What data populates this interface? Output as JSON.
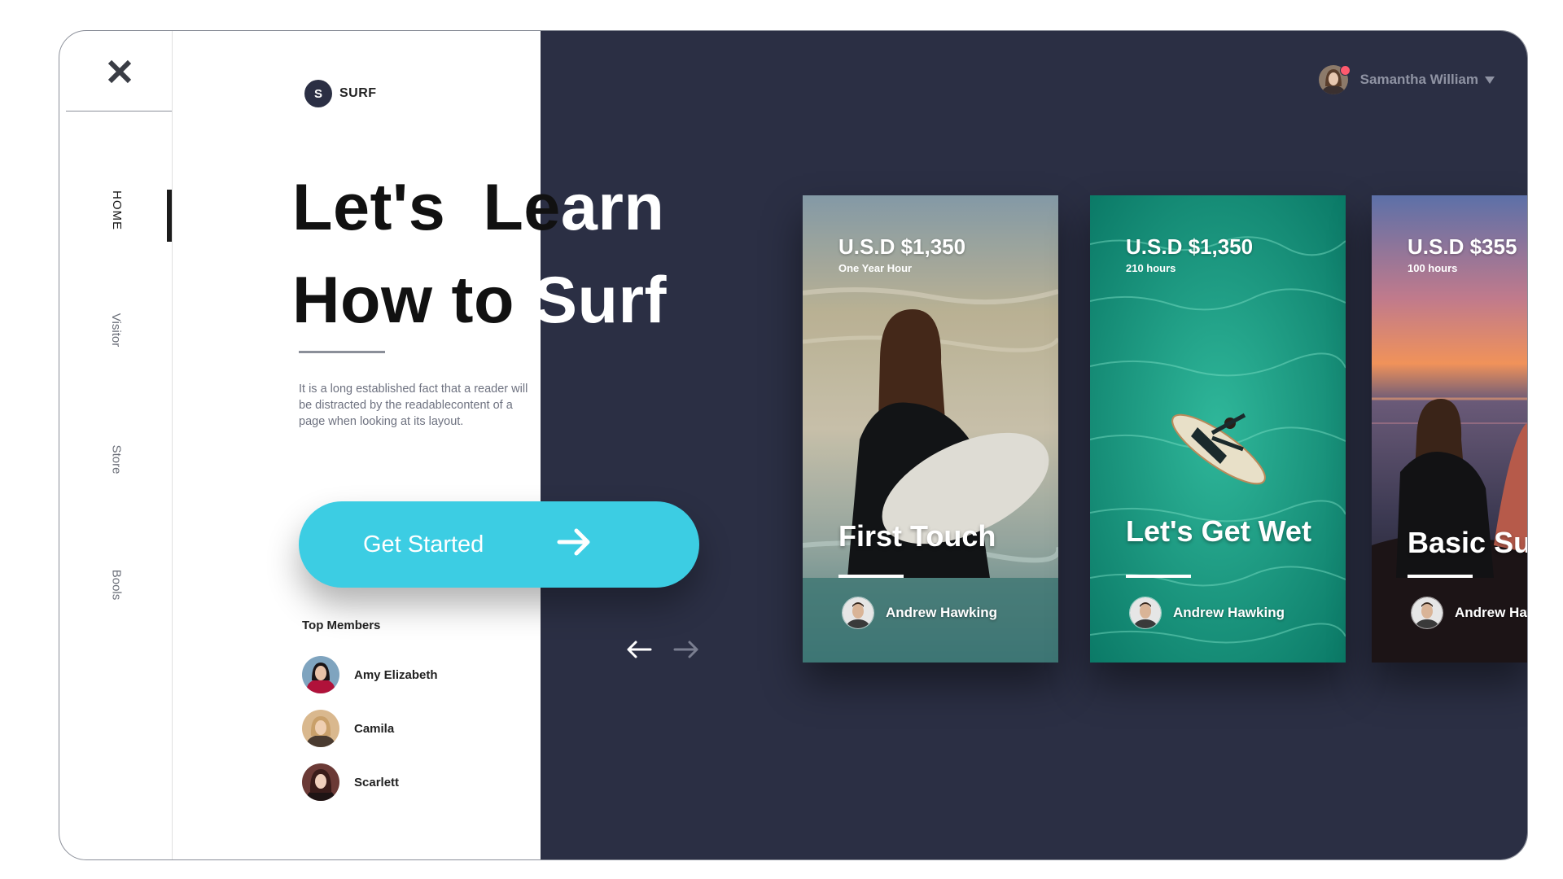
{
  "brand": {
    "logo_letter": "S",
    "name": "SURF"
  },
  "sidebar": {
    "close_icon": "close-icon",
    "items": [
      {
        "label": "HOME",
        "active": true
      },
      {
        "label": "Visitor",
        "active": false
      },
      {
        "label": "Store",
        "active": false
      },
      {
        "label": "Bools",
        "active": false
      }
    ]
  },
  "hero": {
    "line1_a": "Let's  Le",
    "line1_b": "arn",
    "line2_a": "How to ",
    "line2_b": "Surf",
    "description": "It is a long established fact that a reader will be distracted by the readablecontent of a page when looking at its layout.",
    "cta_label": "Get Started",
    "cta_icon": "arrow-right-icon"
  },
  "members": {
    "title": "Top Members",
    "list": [
      {
        "name": "Amy Elizabeth"
      },
      {
        "name": "Camila"
      },
      {
        "name": "Scarlett"
      }
    ]
  },
  "slider": {
    "prev_icon": "arrow-left-icon",
    "next_icon": "arrow-right-icon"
  },
  "profile": {
    "name": "Samantha William",
    "has_notification": true,
    "caret_icon": "caret-down-icon"
  },
  "cards": [
    {
      "price": "U.S.D $1,350",
      "duration": "One Year Hour",
      "title": "First Touch",
      "author": "Andrew Hawking"
    },
    {
      "price": "U.S.D $1,350",
      "duration": "210 hours",
      "title": "Let's Get Wet",
      "author": "Andrew Hawking"
    },
    {
      "price": "U.S.D $355",
      "duration": "100 hours",
      "title": "Basic Surf",
      "author": "Andrew Haw"
    }
  ],
  "colors": {
    "dark_panel": "#2b2f44",
    "accent": "#3ccde3",
    "notification": "#ff5a6e"
  }
}
